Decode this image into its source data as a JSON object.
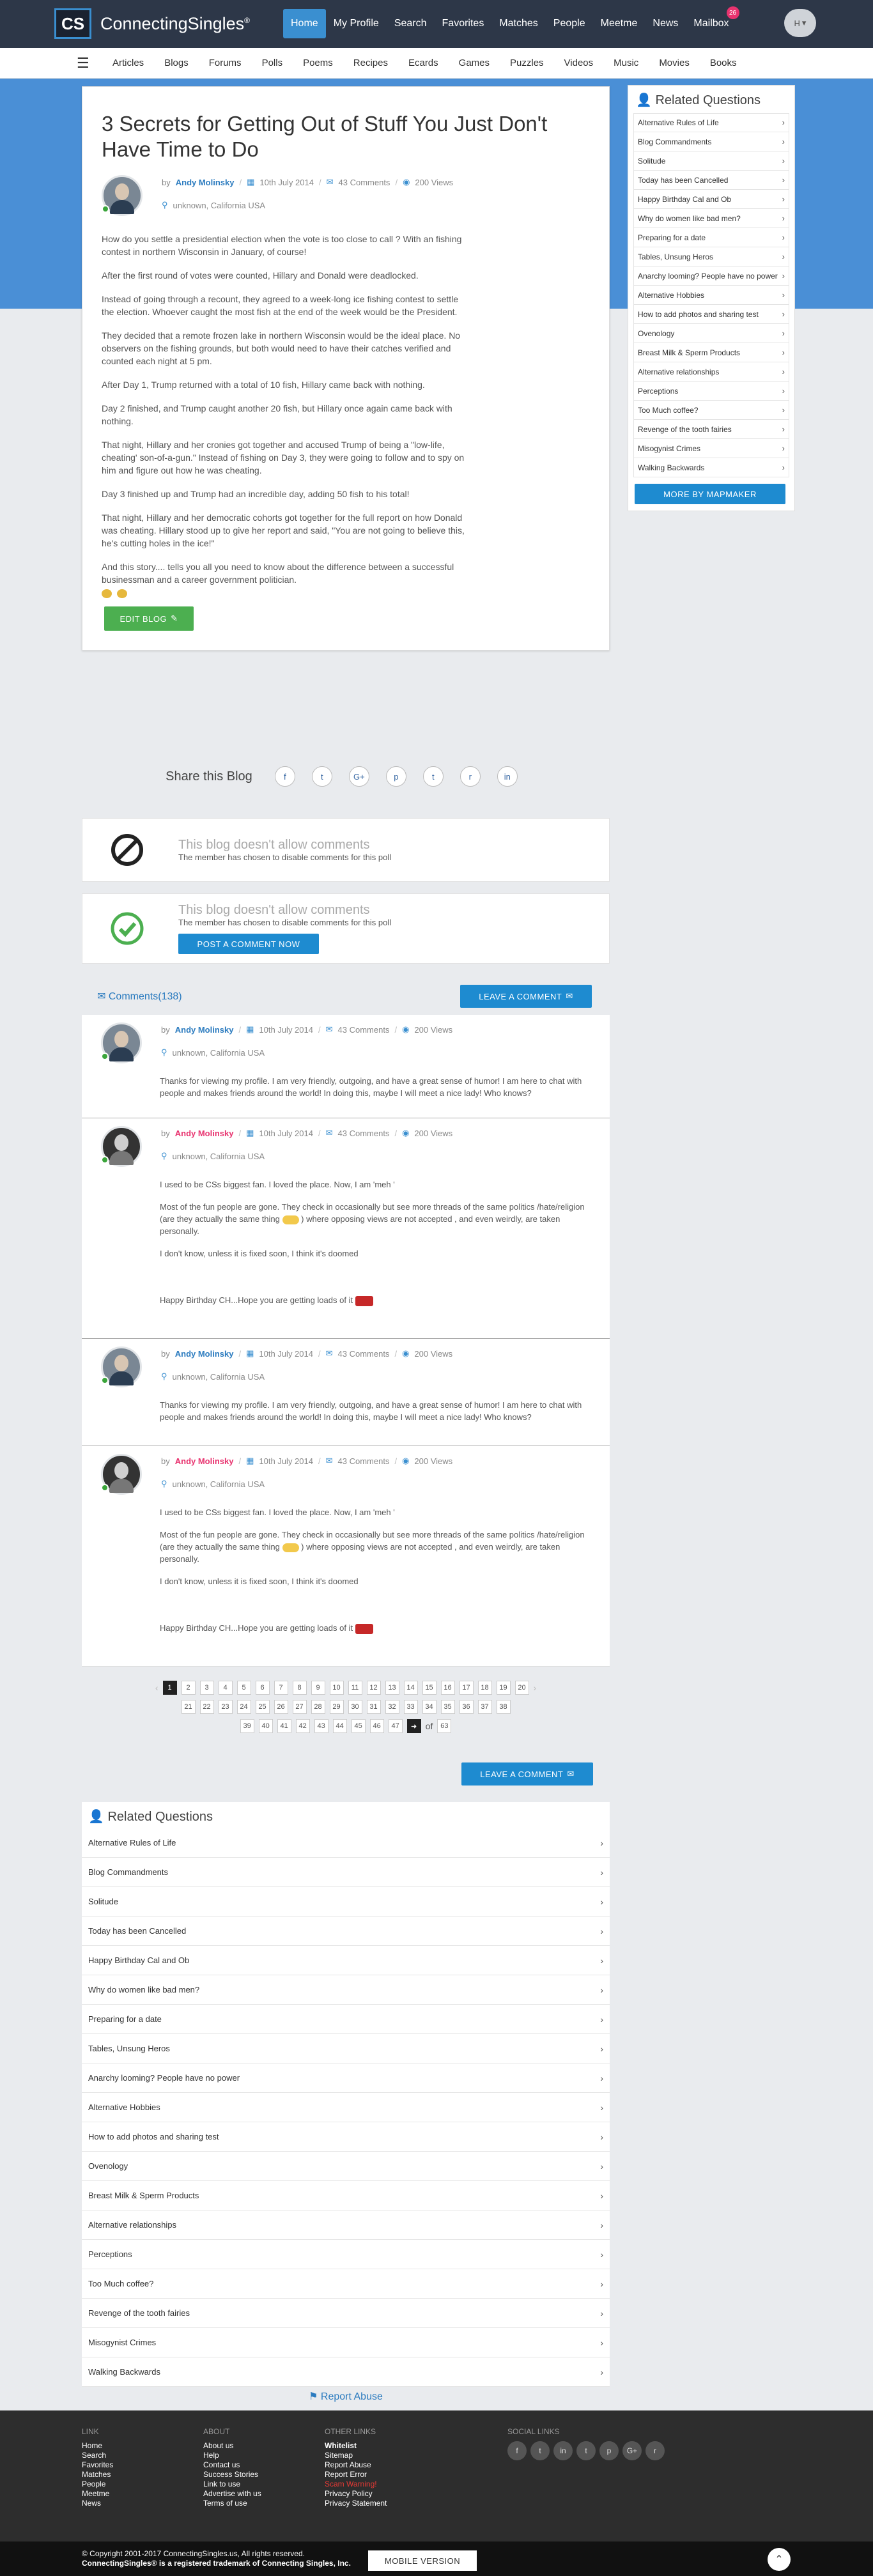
{
  "header": {
    "logo_short": "CS",
    "brand": "ConnectingSingles",
    "brand_mark": "®",
    "nav": [
      "Home",
      "My Profile",
      "Search",
      "Favorites",
      "Matches",
      "People",
      "Meetme",
      "News",
      "Mailbox"
    ],
    "mailbox_badge": "26",
    "avatar_text": "H"
  },
  "subnav": [
    "Articles",
    "Blogs",
    "Forums",
    "Polls",
    "Poems",
    "Recipes",
    "Ecards",
    "Games",
    "Puzzles",
    "Videos",
    "Music",
    "Movies",
    "Books"
  ],
  "post": {
    "title": "3 Secrets for Getting Out of Stuff You Just Don't Have Time to Do",
    "by": "by",
    "author": "Andy Molinsky",
    "date": "10th July 2014",
    "comments": "43 Comments",
    "views": "200 Views",
    "location": "unknown, California USA",
    "paragraphs": [
      "How do you settle a presidential election when the vote is too close to call ? With an fishing contest in northern Wisconsin in January, of course!",
      "After the first round of votes were counted, Hillary and Donald were deadlocked.",
      "Instead of going through a recount, they agreed to a week-long ice fishing contest to settle the election. Whoever caught the most fish at the end of the week would be the President.",
      "They decided that a remote frozen lake in northern Wisconsin would be the ideal place. No observers on the fishing grounds, but both would need to have their catches verified and counted each night at 5 pm.",
      "After Day 1, Trump returned with a total of 10 fish, Hillary came back with nothing.",
      "Day 2 finished, and Trump caught another 20 fish, but Hillary once again came back with nothing.",
      "That night, Hillary and her cronies got together and accused Trump of being a \"low-life, cheating' son-of-a-gun.\" Instead of fishing on Day 3, they were going to follow and to spy on him and figure out how he was cheating.",
      "Day 3 finished up and Trump had an incredible day, adding 50 fish to his total!",
      "That night, Hillary and her democratic cohorts got together for the full report on how Donald was cheating. Hillary stood up to give her report and said, \"You are not going to believe this, he's cutting holes in the ice!\"",
      "And this story.... tells you all you need to know about the difference between a successful businessman and a career government politician."
    ],
    "edit_button": "EDIT BLOG"
  },
  "share": {
    "label": "Share this Blog",
    "icons": [
      "f",
      "t",
      "G+",
      "p",
      "t",
      "r",
      "in"
    ]
  },
  "no_comments_1": {
    "title": "This blog doesn't allow comments",
    "sub": "The member has chosen to disable comments for this poll"
  },
  "no_comments_2": {
    "title": "This blog doesn't allow comments",
    "sub": "The member has chosen to disable comments for this poll",
    "button": "POST A COMMENT NOW"
  },
  "comments_section": {
    "title": "Comments(138)",
    "leave_button": "LEAVE A COMMENT"
  },
  "comments": [
    {
      "author": "Andy Molinsky",
      "date": "10th July 2014",
      "comments": "43 Comments",
      "views": "200 Views",
      "location": "unknown, California USA",
      "text": "Thanks for viewing my profile. I am very friendly, outgoing, and have a great sense of humor! I am here to chat with people and makes friends around the world! In doing this, maybe I will meet a nice lady! Who knows?"
    },
    {
      "author": "Andy Molinsky",
      "date": "10th July 2014",
      "comments": "43 Comments",
      "views": "200 Views",
      "location": "unknown, California USA",
      "p1": "I used to be CSs biggest fan. I loved the place. Now, I am 'meh '",
      "p2a": "Most of the fun people are gone. They check in occasionally but see more threads of the same politics /hate/religion (are they actually the same thing",
      "p2b": ") where opposing views are not accepted , and even weirdly, are taken personally.",
      "p3": "I don't know, unless it is fixed soon, I think it's doomed",
      "p4": "Happy Birthday CH...Hope you are getting loads of it"
    },
    {
      "author": "Andy Molinsky",
      "date": "10th July 2014",
      "comments": "43 Comments",
      "views": "200 Views",
      "location": "unknown, California USA",
      "text": "Thanks for viewing my profile. I am very friendly, outgoing, and have a great sense of humor! I am here to chat with people and makes friends around the world! In doing this, maybe I will meet a nice lady! Who knows?"
    },
    {
      "author": "Andy Molinsky",
      "date": "10th July 2014",
      "comments": "43 Comments",
      "views": "200 Views",
      "location": "unknown, California USA",
      "p1": "I used to be CSs biggest fan. I loved the place. Now, I am 'meh '",
      "p2a": "Most of the fun people are gone. They check in occasionally but see more threads of the same politics /hate/religion (are they actually the same thing",
      "p2b": ") where opposing views are not accepted , and even weirdly, are taken personally.",
      "p3": "I don't know, unless it is fixed soon, I think it's doomed",
      "p4": "Happy Birthday CH...Hope you are getting loads of it"
    }
  ],
  "pager": {
    "row1": [
      "1",
      "2",
      "3",
      "4",
      "5",
      "6",
      "7",
      "8",
      "9",
      "10",
      "11",
      "12",
      "13",
      "14",
      "15",
      "16",
      "17",
      "18",
      "19",
      "20"
    ],
    "row2": [
      "21",
      "22",
      "23",
      "24",
      "25",
      "26",
      "27",
      "28",
      "29",
      "30",
      "31",
      "32",
      "33",
      "34",
      "35",
      "36",
      "37",
      "38"
    ],
    "row3": [
      "39",
      "40",
      "41",
      "42",
      "43",
      "44",
      "45",
      "46",
      "47"
    ],
    "of": "of",
    "total": "63"
  },
  "leave_button_2": "LEAVE A COMMENT",
  "related": {
    "title": "Related Questions",
    "items": [
      "Alternative Rules of Life",
      "Blog Commandments",
      "Solitude",
      "Today has been Cancelled",
      "Happy Birthday Cal and Ob",
      "Why do women like bad men?",
      "Preparing for a date",
      "Tables, Unsung Heros",
      "Anarchy looming? People have no power",
      "Alternative Hobbies",
      "How to add photos and sharing test",
      "Ovenology",
      "Breast Milk & Sperm Products",
      "Alternative relationships",
      "Perceptions",
      "Too Much coffee?",
      "Revenge of the tooth fairies",
      "Misogynist Crimes",
      "Walking Backwards"
    ],
    "more_button": "MORE BY MAPMAKER"
  },
  "report_abuse": "Report Abuse",
  "footer": {
    "link_head": "LINK",
    "links": [
      "Home",
      "Search",
      "Favorites",
      "Matches",
      "People",
      "Meetme",
      "News"
    ],
    "about_head": "ABOUT",
    "about": [
      "About us",
      "Help",
      "Contact us",
      "Success Stories",
      "Link to use",
      "Advertise with us",
      "Terms of use"
    ],
    "other_head": "OTHER LINKS",
    "other": [
      "Whitelist",
      "Sitemap",
      "Report Abuse",
      "Report Error",
      "Scam Warning!",
      "Privacy Policy",
      "Privacy Statement"
    ],
    "social_head": "SOCIAL LINKS",
    "social": [
      "f",
      "t",
      "in",
      "t",
      "p",
      "G+",
      "r"
    ],
    "copyright": "© Copyright 2001-2017 ConnectingSingles.us, All rights reserved.",
    "trademark": "ConnectingSingles® is a registered trademark of Connecting Singles, Inc.",
    "mobile": "MOBILE VERSION"
  },
  "colors": {
    "accent": "#3a8fd0",
    "banner": "#4a8fd6",
    "topbar": "#2d3748",
    "green": "#4caf50",
    "pink": "#e8336f"
  }
}
